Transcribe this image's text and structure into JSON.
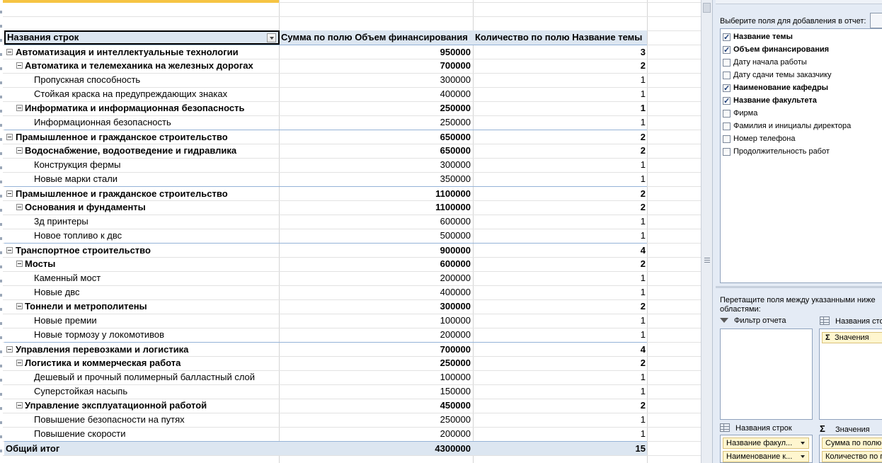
{
  "pivot": {
    "header": {
      "row_labels": "Названия строк",
      "sum_column": "Сумма по полю Объем финансирования",
      "count_column": "Количество по полю Название темы"
    },
    "rows": [
      {
        "level": 0,
        "label": "Автоматизация и интеллектуальные технологии",
        "sum": "950000",
        "count": "3"
      },
      {
        "level": 1,
        "label": "Автоматика и телемеханика на железных дорогах",
        "sum": "700000",
        "count": "2"
      },
      {
        "level": 2,
        "label": "Пропускная способность",
        "sum": "300000",
        "count": "1"
      },
      {
        "level": 2,
        "label": "Стойкая краска на предупреждающих знаках",
        "sum": "400000",
        "count": "1"
      },
      {
        "level": 1,
        "label": "Информатика и информационная безопасность",
        "sum": "250000",
        "count": "1"
      },
      {
        "level": 2,
        "label": "Информационная безопасность",
        "sum": "250000",
        "count": "1"
      },
      {
        "level": 0,
        "label": "Прамышленное и гражданское строительство",
        "sum": "650000",
        "count": "2"
      },
      {
        "level": 1,
        "label": "Водоснабжение, водоотведение и гидравлика",
        "sum": "650000",
        "count": "2"
      },
      {
        "level": 2,
        "label": "Конструкция фермы",
        "sum": "300000",
        "count": "1"
      },
      {
        "level": 2,
        "label": "Новые марки стали",
        "sum": "350000",
        "count": "1"
      },
      {
        "level": 0,
        "label": "Прамышленное и гражданское строительство",
        "sum": "1100000",
        "count": "2"
      },
      {
        "level": 1,
        "label": "Основания и фундаменты",
        "sum": "1100000",
        "count": "2"
      },
      {
        "level": 2,
        "label": "3д принтеры",
        "sum": "600000",
        "count": "1"
      },
      {
        "level": 2,
        "label": "Новое топливо к двс",
        "sum": "500000",
        "count": "1"
      },
      {
        "level": 0,
        "label": "Транспортное строительство",
        "sum": "900000",
        "count": "4"
      },
      {
        "level": 1,
        "label": " Мосты",
        "sum": "600000",
        "count": "2"
      },
      {
        "level": 2,
        "label": "Каменный мост",
        "sum": "200000",
        "count": "1"
      },
      {
        "level": 2,
        "label": "Новые двс",
        "sum": "400000",
        "count": "1"
      },
      {
        "level": 1,
        "label": "Тоннели и метрополитены",
        "sum": "300000",
        "count": "2"
      },
      {
        "level": 2,
        "label": "Новые премии",
        "sum": "100000",
        "count": "1"
      },
      {
        "level": 2,
        "label": "Новые тормозу у локомотивов",
        "sum": "200000",
        "count": "1"
      },
      {
        "level": 0,
        "label": "Управления перевозками и логистика",
        "sum": "700000",
        "count": "4"
      },
      {
        "level": 1,
        "label": "Логистика и коммерческая работа",
        "sum": "250000",
        "count": "2"
      },
      {
        "level": 2,
        "label": "Дешевый и прочный полимерный балластный слой",
        "sum": "100000",
        "count": "1"
      },
      {
        "level": 2,
        "label": "Суперстойкая насыпь",
        "sum": "150000",
        "count": "1"
      },
      {
        "level": 1,
        "label": "Управление эксплуатационной работой",
        "sum": "450000",
        "count": "2"
      },
      {
        "level": 2,
        "label": "Повышение безопасности на путях",
        "sum": "250000",
        "count": "1"
      },
      {
        "level": 2,
        "label": "Повышение скорости",
        "sum": "200000",
        "count": "1"
      }
    ],
    "total": {
      "label": "Общий итог",
      "sum": "4300000",
      "count": "15"
    }
  },
  "field_pane": {
    "choose_fields_label": "Выберите поля для добавления в отчет:",
    "fields": [
      {
        "label": "Название темы",
        "checked": true
      },
      {
        "label": "Объем финансирования",
        "checked": true
      },
      {
        "label": "Дату начала работы",
        "checked": false
      },
      {
        "label": "Дату сдачи темы заказчику",
        "checked": false
      },
      {
        "label": "Наименование кафедры",
        "checked": true
      },
      {
        "label": "Название факультета",
        "checked": true
      },
      {
        "label": "Фирма",
        "checked": false
      },
      {
        "label": "Фамилия и инициалы директора",
        "checked": false
      },
      {
        "label": "Номер телефона",
        "checked": false
      },
      {
        "label": "Продолжительность работ",
        "checked": false
      }
    ],
    "drag_hint": "Перетащите поля между указанными ниже областями:",
    "areas": {
      "report_filter": "Фильтр отчета",
      "column_labels": "Названия сто",
      "row_labels": "Названия строк",
      "values": "Значения"
    },
    "column_chips": [
      "Значения"
    ],
    "row_chips": [
      "Название факул...",
      "Наименование к..."
    ],
    "value_chips": [
      "Сумма по полю О",
      "Количество по п"
    ]
  }
}
